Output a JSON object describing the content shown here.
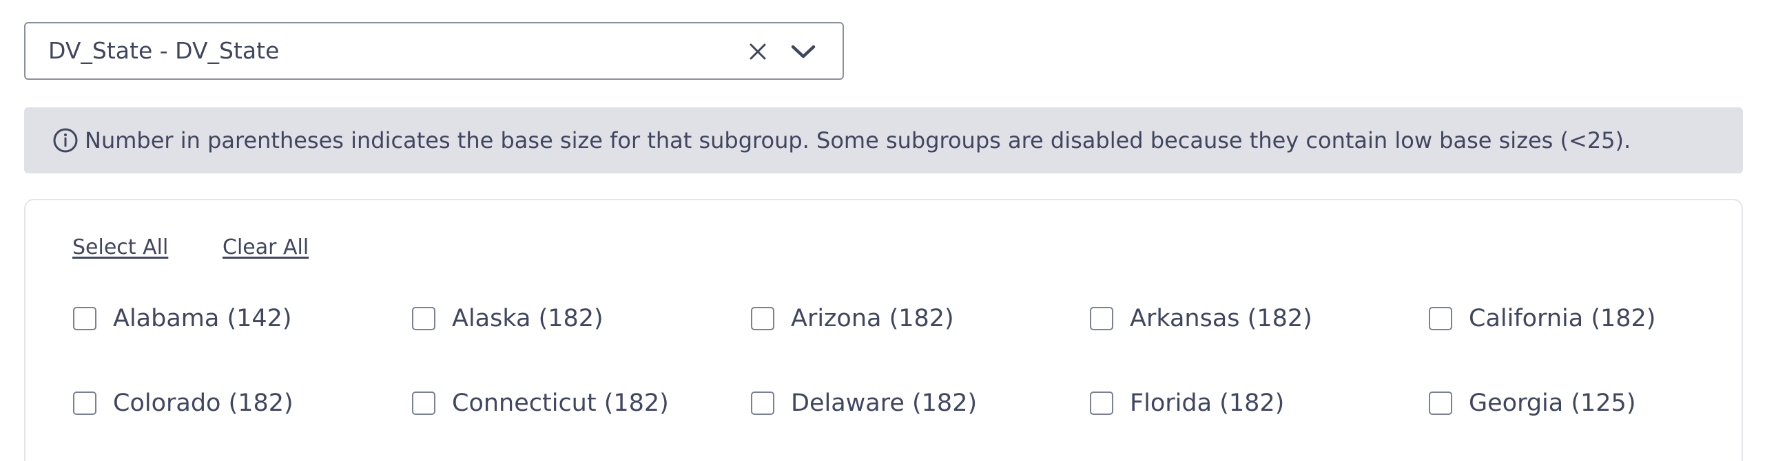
{
  "dropdown": {
    "value": "DV_State - DV_State",
    "clear_icon": "close-icon",
    "expand_icon": "chevron-down-icon"
  },
  "info_banner": {
    "icon": "info-icon",
    "text": "Number in parentheses indicates the base size for that subgroup. Some subgroups are disabled because they contain low base sizes (<25)."
  },
  "actions": {
    "select_all": "Select All",
    "clear_all": "Clear All"
  },
  "options": [
    {
      "label": "Alabama (142)",
      "checked": false
    },
    {
      "label": "Alaska (182)",
      "checked": false
    },
    {
      "label": "Arizona (182)",
      "checked": false
    },
    {
      "label": "Arkansas (182)",
      "checked": false
    },
    {
      "label": "California (182)",
      "checked": false
    },
    {
      "label": "Colorado (182)",
      "checked": false
    },
    {
      "label": "Connecticut (182)",
      "checked": false
    },
    {
      "label": "Delaware (182)",
      "checked": false
    },
    {
      "label": "Florida (182)",
      "checked": false
    },
    {
      "label": "Georgia (125)",
      "checked": false
    }
  ],
  "colors": {
    "text": "#3f4660",
    "banner_bg": "#e0e1e6",
    "border": "#8a8f9e",
    "checkbox_border": "#7a8095"
  }
}
